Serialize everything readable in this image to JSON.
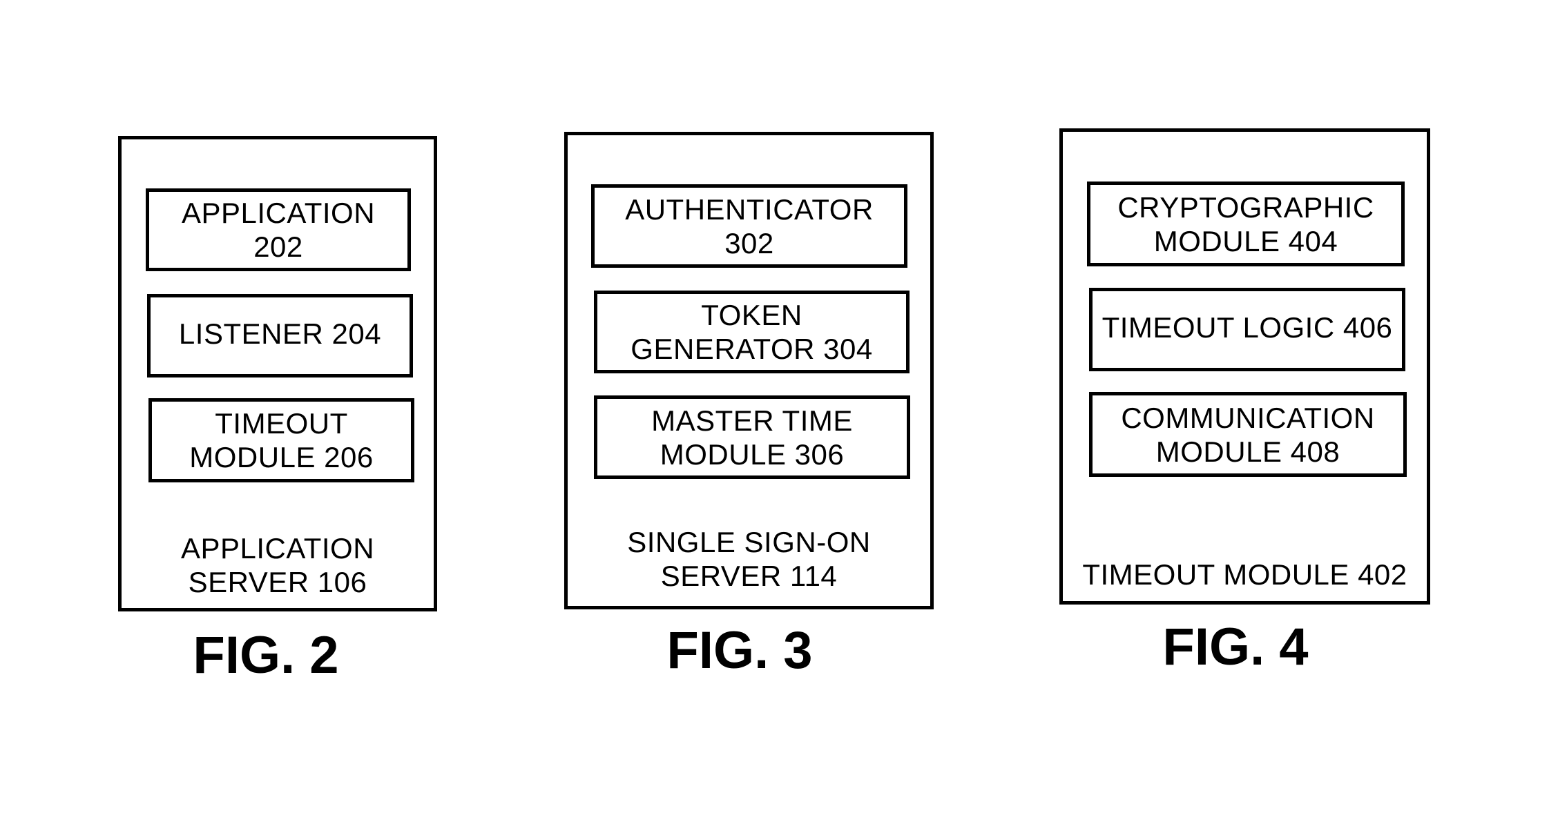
{
  "figures": [
    {
      "id": "fig2",
      "label": "FIG. 2",
      "container": {
        "line1": "APPLICATION",
        "line2": "SERVER 106"
      },
      "components": [
        {
          "line1": "APPLICATION",
          "line2": "202"
        },
        {
          "line1": "LISTENER 204"
        },
        {
          "line1": "TIMEOUT",
          "line2": "MODULE 206"
        }
      ]
    },
    {
      "id": "fig3",
      "label": "FIG. 3",
      "container": {
        "line1": "SINGLE SIGN-ON",
        "line2": "SERVER 114"
      },
      "components": [
        {
          "line1": "AUTHENTICATOR",
          "line2": "302"
        },
        {
          "line1": "TOKEN",
          "line2": "GENERATOR 304"
        },
        {
          "line1": "MASTER TIME",
          "line2": "MODULE 306"
        }
      ]
    },
    {
      "id": "fig4",
      "label": "FIG. 4",
      "container": {
        "line1": "TIMEOUT MODULE 402"
      },
      "components": [
        {
          "line1": "CRYPTOGRAPHIC",
          "line2": "MODULE 404"
        },
        {
          "line1": "TIMEOUT LOGIC 406"
        },
        {
          "line1": "COMMUNICATION",
          "line2": "MODULE 408"
        }
      ]
    }
  ]
}
